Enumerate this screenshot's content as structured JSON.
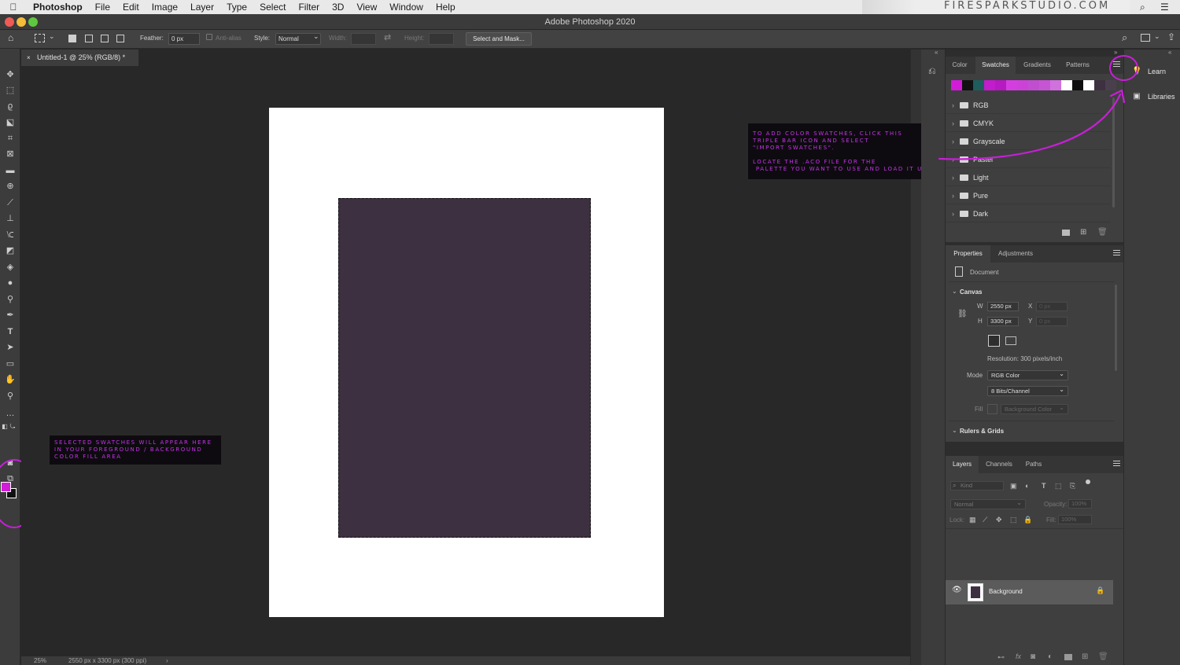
{
  "menubar": {
    "app_name": "Photoshop",
    "items": [
      "File",
      "Edit",
      "Image",
      "Layer",
      "Type",
      "Select",
      "Filter",
      "3D",
      "View",
      "Window",
      "Help"
    ],
    "brand_overlay": "FIRESPARKSTUDIO.COM"
  },
  "window": {
    "title": "Adobe Photoshop 2020"
  },
  "options_bar": {
    "feather_label": "Feather:",
    "feather_value": "0 px",
    "anti_alias_label": "Anti-alias",
    "style_label": "Style:",
    "style_value": "Normal",
    "width_label": "Width:",
    "height_label": "Height:",
    "select_mask_button": "Select and Mask..."
  },
  "document": {
    "tab_title": "Untitled-1 @ 25% (RGB/8) *",
    "close_glyph": "×",
    "status_zoom": "25%",
    "status_info": "2550 px x 3300 px (300 ppi)"
  },
  "annotations": {
    "swatches_note": "TO ADD COLOR SWATCHES, CLICK THIS\nTRIPLE BAR ICON AND SELECT\n\"IMPORT SWATCHES\".\n\nLOCATE THE .ACO FILE FOR THE\n PALETTE YOU WANT TO USE AND LOAD IT UP",
    "foreground_note": "SELECTED SWATCHES WILL APPEAR HERE\nIN YOUR FOREGROUND / BACKGROUND\nCOLOR FILL AREA"
  },
  "swatches_panel": {
    "tabs": [
      "Color",
      "Swatches",
      "Gradients",
      "Patterns"
    ],
    "active_tab": "Swatches",
    "strip_colors": [
      "#d21cd8",
      "#111111",
      "#1f5c5c",
      "#c21ccc",
      "#b719c3",
      "#d43ee0",
      "#cc42d8",
      "#c14ed0",
      "#c655d3",
      "#d071dd",
      "#ffffff",
      "#0e0e0e",
      "#ffffff",
      "#3d3141",
      "#4a3f4d"
    ],
    "folders": [
      "RGB",
      "CMYK",
      "Grayscale",
      "Pastel",
      "Light",
      "Pure",
      "Dark"
    ]
  },
  "properties_panel": {
    "tabs": [
      "Properties",
      "Adjustments"
    ],
    "active_tab": "Properties",
    "type_label": "Document",
    "canvas_section": "Canvas",
    "w_label": "W",
    "w_value": "2550 px",
    "h_label": "H",
    "h_value": "3300 px",
    "x_label": "X",
    "x_value": "0 px",
    "y_label": "Y",
    "y_value": "0 px",
    "resolution": "Resolution: 300 pixels/inch",
    "mode_label": "Mode",
    "mode_value": "RGB Color",
    "depth_value": "8 Bits/Channel",
    "fill_label": "Fill",
    "fill_value": "Background Color",
    "rulers_section": "Rulers & Grids"
  },
  "layers_panel": {
    "tabs": [
      "Layers",
      "Channels",
      "Paths"
    ],
    "active_tab": "Layers",
    "filter_placeholder": "Kind",
    "blend_mode": "Normal",
    "opacity_label": "Opacity:",
    "opacity_value": "100%",
    "lock_label": "Lock:",
    "fill_label": "Fill:",
    "fill_value": "100%",
    "layers": [
      {
        "name": "Background",
        "locked": true,
        "visible": true
      }
    ]
  },
  "right_strip": {
    "items": [
      "Learn",
      "Libraries"
    ]
  },
  "colors": {
    "foreground": "#d21cd8",
    "background": "#111111",
    "selection_fill": "#3d3141",
    "annotation_accent": "#c71fd7"
  }
}
